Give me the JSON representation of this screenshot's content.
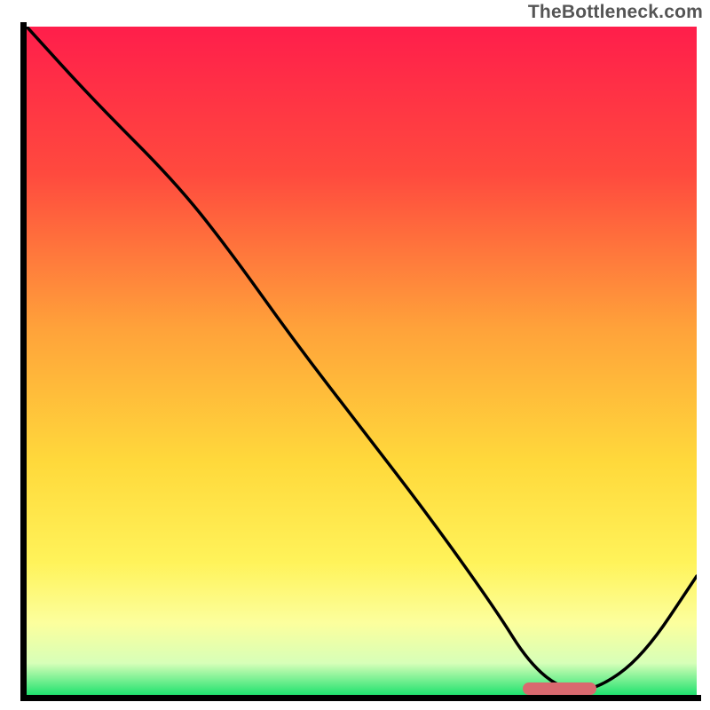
{
  "watermark": "TheBottleneck.com",
  "chart_data": {
    "type": "line",
    "title": "",
    "xlabel": "",
    "ylabel": "",
    "xlim": [
      0,
      100
    ],
    "ylim": [
      0,
      100
    ],
    "gradient_stops": [
      {
        "pct": 0,
        "color": "#ff1e4b"
      },
      {
        "pct": 22,
        "color": "#ff4a3e"
      },
      {
        "pct": 45,
        "color": "#ffa23a"
      },
      {
        "pct": 65,
        "color": "#ffd93b"
      },
      {
        "pct": 80,
        "color": "#fff35a"
      },
      {
        "pct": 89,
        "color": "#fcff9d"
      },
      {
        "pct": 95,
        "color": "#d7ffb8"
      },
      {
        "pct": 100,
        "color": "#16e06b"
      }
    ],
    "x": [
      0,
      10,
      22,
      30,
      40,
      50,
      60,
      70,
      75,
      80,
      85,
      92,
      100
    ],
    "values": [
      100,
      89,
      77,
      67,
      53,
      40,
      27,
      13,
      5,
      1,
      1,
      6,
      18
    ],
    "marker": {
      "x_start": 74,
      "x_end": 85,
      "y": 1.2
    },
    "marker_color": "#d9696f",
    "line_color": "#000000"
  }
}
